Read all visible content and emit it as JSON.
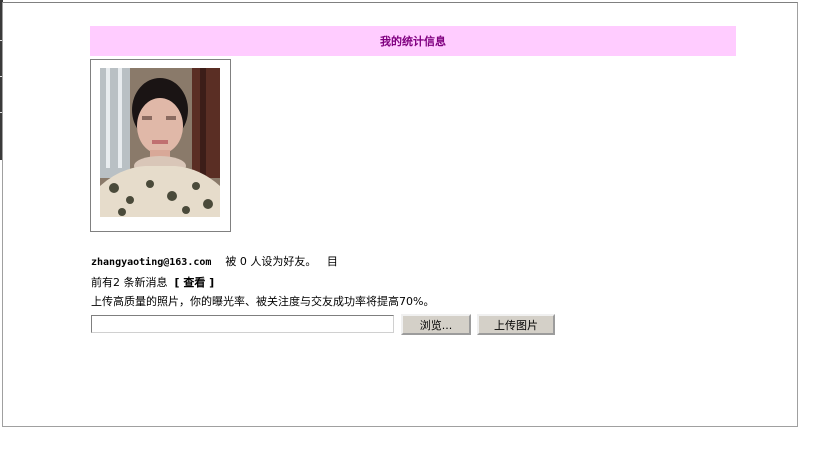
{
  "header": {
    "title": "我的统计信息"
  },
  "profile": {
    "email": "zhangyaoting@163.com",
    "friend_prefix": "被",
    "friend_count": "0",
    "friend_suffix": "人设为好友。",
    "trailing_mark": "目"
  },
  "messages": {
    "prefix": "前有",
    "count": "2",
    "suffix": "条新消息",
    "view_link": "[ 查看 ]"
  },
  "upload": {
    "tip": "上传高质量的照片，你的曝光率、被关注度与交友成功率将提高70%。",
    "file_value": "",
    "browse_label": "浏览...",
    "upload_label": "上传图片"
  }
}
